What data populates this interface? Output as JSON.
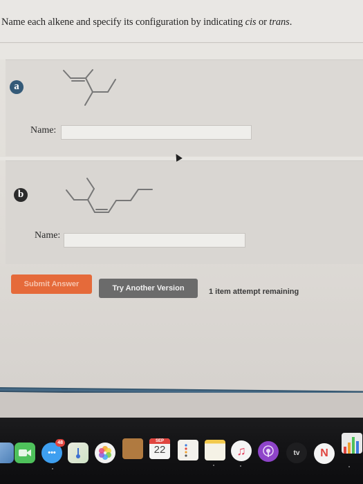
{
  "instruction": {
    "prefix": "Name each alkene and specify its configuration by indicating ",
    "cis": "cis",
    "middle": " or ",
    "trans": "trans",
    "suffix": "."
  },
  "questions": [
    {
      "badge": "a",
      "label": "Name:",
      "value": "",
      "placeholder": ""
    },
    {
      "badge": "b",
      "label": "Name:",
      "value": "",
      "placeholder": ""
    }
  ],
  "actions": {
    "submit_label": "Submit Answer",
    "try_another_label": "Try Another Version",
    "attempts_text": "1 item attempt remaining"
  },
  "dock": {
    "items": [
      {
        "name": "finder-icon",
        "label": ""
      },
      {
        "name": "facetime-icon",
        "label": ""
      },
      {
        "name": "messages-icon",
        "label": "",
        "badge": "48"
      },
      {
        "name": "maps-icon",
        "label": ""
      },
      {
        "name": "photos-icon",
        "label": ""
      },
      {
        "name": "contacts-icon",
        "label": ""
      },
      {
        "name": "calendar-icon",
        "label": "22",
        "month": "SEP"
      },
      {
        "name": "reminders-icon",
        "label": ""
      },
      {
        "name": "notes-icon",
        "label": ""
      },
      {
        "name": "music-icon",
        "label": "♫"
      },
      {
        "name": "podcasts-icon",
        "label": ""
      },
      {
        "name": "apple-tv-icon",
        "label": "tv"
      },
      {
        "name": "news-icon",
        "label": "N"
      },
      {
        "name": "numbers-icon",
        "label": ""
      }
    ]
  },
  "colors": {
    "submit": "#e56a3a",
    "try_another": "#6b6b6b",
    "badge_a": "#345a78",
    "badge_b": "#2b2b2b"
  }
}
